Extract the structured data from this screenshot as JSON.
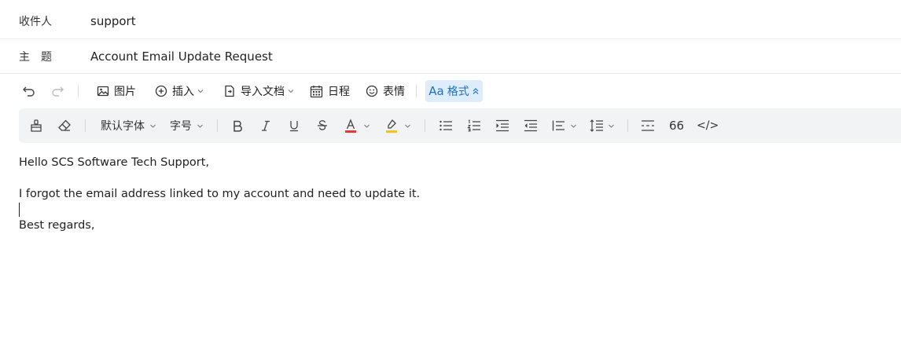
{
  "header": {
    "to_label": "收件人",
    "to_value": "support",
    "subject_label": "主　题",
    "subject_value": "Account Email Update Request"
  },
  "toolbar": {
    "image_label": "图片",
    "insert_label": "插入",
    "import_doc_label": "导入文档",
    "schedule_label": "日程",
    "emoji_label": "表情",
    "format_label": "格式",
    "format_prefix": "Aa"
  },
  "format_bar": {
    "font_family": "默认字体",
    "font_size": "字号",
    "quote_label": "66",
    "code_label": "</>",
    "font_color": "#e53935",
    "highlight_color": "#f6c21b"
  },
  "body": {
    "lines": [
      "Hello SCS Software Tech Support,",
      "",
      "I forgot the email address linked to my account and need to update it.",
      "",
      "Best regards,"
    ]
  }
}
